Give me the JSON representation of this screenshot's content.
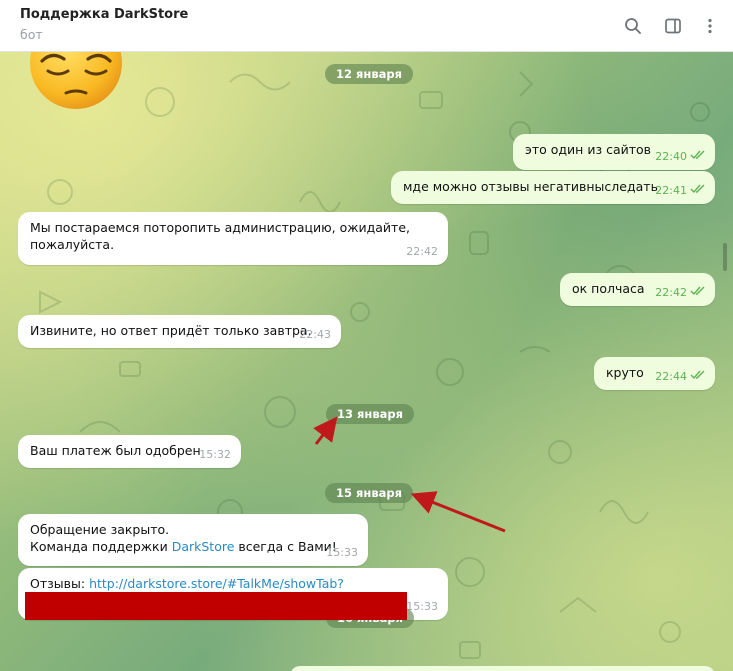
{
  "header": {
    "title": "Поддержка DarkStore",
    "subtitle": "бот",
    "icons": [
      "search-icon",
      "sidebar-toggle-icon",
      "more-vertical-icon"
    ]
  },
  "dates": {
    "jan12": "12 января",
    "jan13": "13 января",
    "jan15": "15 января",
    "jan16": "16 января"
  },
  "messages": {
    "m1": {
      "text": "это один из сайтов",
      "time": "22:40",
      "direction": "out",
      "status": "read"
    },
    "m2": {
      "text": "мде можно отзывы негативныследать",
      "time": "22:41",
      "direction": "out",
      "status": "read"
    },
    "m3": {
      "line1": "Мы постараемся поторопить администрацию, ожидайте,",
      "line2": "пожалуйста.",
      "time": "22:42",
      "direction": "in"
    },
    "m4": {
      "text": "ок полчаса",
      "time": "22:42",
      "direction": "out",
      "status": "read"
    },
    "m5": {
      "text": "Извините, но ответ придёт только завтра.",
      "time": "22:43",
      "direction": "in"
    },
    "m6": {
      "text": "круто",
      "time": "22:44",
      "direction": "out",
      "status": "read"
    },
    "m7": {
      "text": "Ваш платеж был одобрен",
      "time": "15:32",
      "direction": "in"
    },
    "m8": {
      "line1": "Обращение  закрыто.",
      "line2_pre": "Команда поддержки ",
      "brand": "DarkStore",
      "line2_post": " всегда с Вами!",
      "time": "15:33",
      "direction": "in"
    },
    "m9": {
      "label": "Отзывы: ",
      "link": "http://darkstore.store/#TalkMe/showTab?",
      "time": "15:33",
      "direction": "in"
    }
  },
  "colors": {
    "redaction": "#c00000",
    "annotation_arrow": "#c0191b",
    "outgoing_bubble": "#effdde",
    "date_pill": "#5f8250"
  },
  "sticker": "pensive-face-emoji"
}
